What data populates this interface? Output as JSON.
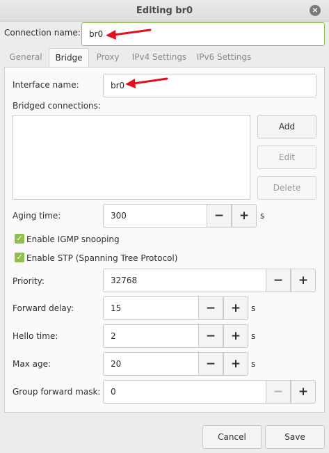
{
  "window": {
    "title": "Editing br0",
    "close_glyph": "×"
  },
  "connection": {
    "label": "Connection name:",
    "value": "br0"
  },
  "tabs": [
    {
      "label": "General"
    },
    {
      "label": "Bridge"
    },
    {
      "label": "Proxy"
    },
    {
      "label": "IPv4 Settings"
    },
    {
      "label": "IPv6 Settings"
    }
  ],
  "bridge": {
    "interface_label": "Interface name:",
    "interface_value": "br0",
    "bridged_label": "Bridged connections:",
    "add_label": "Add",
    "edit_label": "Edit",
    "delete_label": "Delete",
    "aging_label": "Aging time:",
    "aging_value": "300",
    "aging_unit": "s",
    "igmp_label": "Enable IGMP snooping",
    "stp_label": "Enable STP (Spanning Tree Protocol)",
    "priority_label": "Priority:",
    "priority_value": "32768",
    "forward_label": "Forward delay:",
    "forward_value": "15",
    "forward_unit": "s",
    "hello_label": "Hello time:",
    "hello_value": "2",
    "hello_unit": "s",
    "maxage_label": "Max age:",
    "maxage_value": "20",
    "maxage_unit": "s",
    "mask_label": "Group forward mask:",
    "mask_value": "0"
  },
  "spin": {
    "minus": "−",
    "plus": "+"
  },
  "check_glyph": "✓",
  "footer": {
    "cancel_label": "Cancel",
    "save_label": "Save"
  },
  "colors": {
    "accent_green": "#8fbf4c",
    "arrow_red": "#e0101e"
  }
}
